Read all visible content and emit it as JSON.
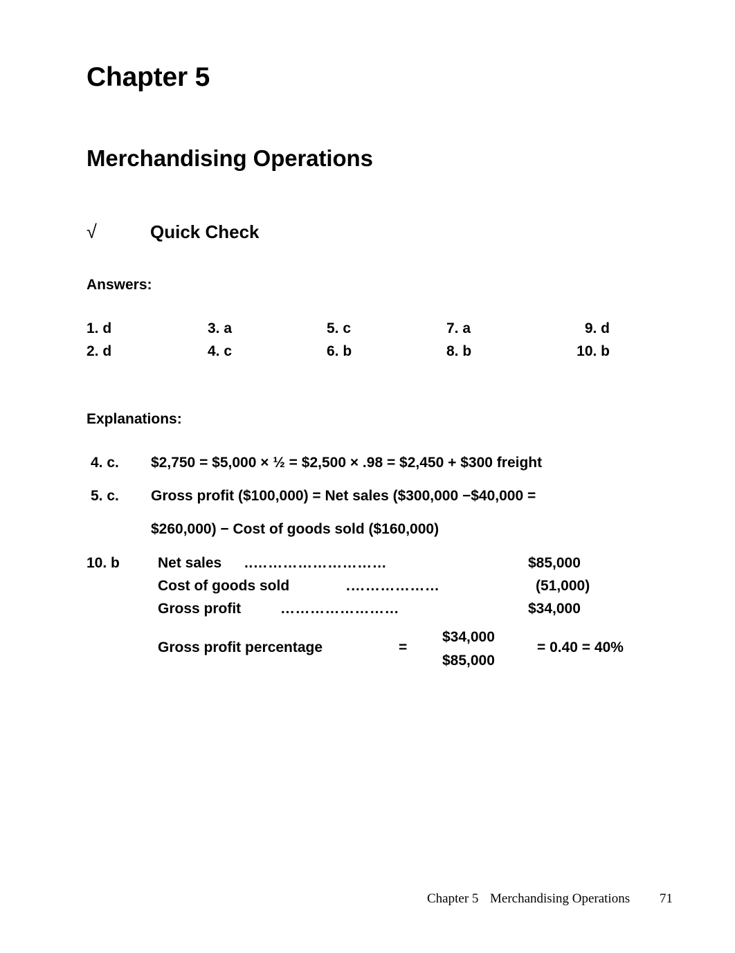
{
  "document": {
    "chapter_heading": "Chapter 5",
    "title_heading": "Merchandising Operations",
    "quick_check": {
      "radical_symbol": "√",
      "label": "Quick Check"
    },
    "answers_label": "Answers:",
    "explanations_label": "Explanations:"
  },
  "answers": {
    "rows": [
      [
        {
          "number": "1.",
          "answer": "d"
        },
        {
          "number": "3.",
          "answer": "a"
        },
        {
          "number": "5.",
          "answer": "c"
        },
        {
          "number": "7.",
          "answer": "a"
        },
        {
          "number": "9.",
          "answer": "d"
        }
      ],
      [
        {
          "number": "2.",
          "answer": "d"
        },
        {
          "number": "4.",
          "answer": "c"
        },
        {
          "number": "6.",
          "answer": "b"
        },
        {
          "number": "8.",
          "answer": "b"
        },
        {
          "number": "10.",
          "answer": "b"
        }
      ]
    ],
    "cells": {
      "r0c0": "1.  d",
      "r0c1": "3.  a",
      "r0c2": "5.  c",
      "r0c3": "7.  a",
      "r0c4": "9. d",
      "r1c0": "2.  d",
      "r1c1": "4.  c",
      "r1c2": "6.  b",
      "r1c3": "8.  b",
      "r1c4": "10. b"
    }
  },
  "explanations": {
    "item_4": {
      "tag": "4. c.",
      "text": "$2,750 = $5,000 × ½ = $2,500 × .98 = $2,450 + $300 freight"
    },
    "item_5": {
      "tag": "5. c.",
      "line1": "Gross profit ($100,000) = Net sales ($300,000  −$40,000 =",
      "line2": "$260,000) − Cost of goods sold ($160,000)"
    },
    "item_10": {
      "tag": "10. b",
      "statement": {
        "rows": [
          {
            "label": "Net sales",
            "leader": "………………………..",
            "value": "$85,000"
          },
          {
            "label": "Cost of goods sold",
            "leader": "……………….",
            "value": "(51,000)"
          },
          {
            "label": "Gross profit",
            "leader": "……………………",
            "value": "$34,000"
          }
        ]
      },
      "ratio": {
        "label": "Gross profit percentage",
        "equals": "=",
        "numerator": "$34,000",
        "denominator": "$85,000",
        "result": "= 0.40 = 40%"
      }
    }
  },
  "footer": {
    "chapter": "Chapter 5",
    "title": "Merchandising Operations",
    "page_number": "71"
  }
}
